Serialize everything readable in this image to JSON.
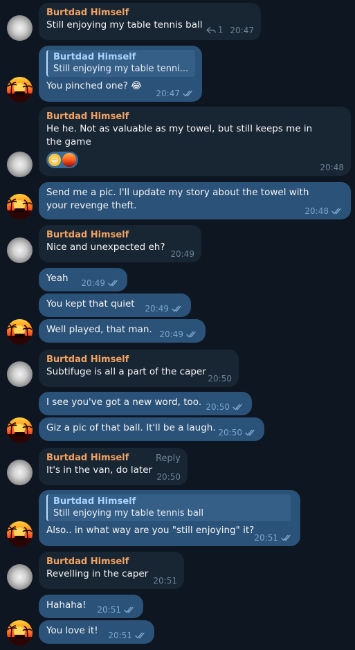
{
  "contact": {
    "name": "Burtdad Himself"
  },
  "messages": [
    {
      "id": "m1",
      "dir": "in",
      "sender": "Burtdad Himself",
      "text": "Still enjoying my table tennis ball",
      "time": "20:47",
      "reply_count": "1"
    },
    {
      "id": "m2",
      "dir": "out",
      "quote_name": "Burtdad Himself",
      "quote_text": "Still enjoying my table tenni...",
      "text": "You pinched one? 😂",
      "time": "20:47"
    },
    {
      "id": "m3",
      "dir": "in",
      "sender": "Burtdad Himself",
      "text": "He he. Not as valuable as my towel, but still keeps me in the game",
      "time": "20:48",
      "reaction_emoji": "😁"
    },
    {
      "id": "m4",
      "dir": "out",
      "text": "Send me a pic. I'll update my story about the towel with your revenge theft.",
      "time": "20:48"
    },
    {
      "id": "m5",
      "dir": "in",
      "sender": "Burtdad Himself",
      "text": "Nice and unexpected eh?",
      "time": "20:49"
    },
    {
      "id": "m6",
      "dir": "out",
      "text": "Yeah",
      "time": "20:49"
    },
    {
      "id": "m7",
      "dir": "out",
      "text": "You kept that quiet",
      "time": "20:49"
    },
    {
      "id": "m8",
      "dir": "out",
      "text": "Well played, that man.",
      "time": "20:49"
    },
    {
      "id": "m9",
      "dir": "in",
      "sender": "Burtdad Himself",
      "text": "Subtifuge is all a part of the caper",
      "time": "20:50"
    },
    {
      "id": "m10",
      "dir": "out",
      "text": "I see you've got a new word, too.",
      "time": "20:50"
    },
    {
      "id": "m11",
      "dir": "out",
      "text": "Giz a pic of that ball. It'll be a laugh.",
      "time": "20:50"
    },
    {
      "id": "m12",
      "dir": "in",
      "sender": "Burtdad Himself",
      "text": "It's in the van, do later",
      "time": "20:50",
      "reply_label": "Reply"
    },
    {
      "id": "m13",
      "dir": "out",
      "quote_name": "Burtdad Himself",
      "quote_text": "Still enjoying my table tennis ball",
      "text": "Also.. in what way are you \"still enjoying\" it?",
      "time": "20:51"
    },
    {
      "id": "m14",
      "dir": "in",
      "sender": "Burtdad Himself",
      "text": "Revelling in the caper",
      "time": "20:51"
    },
    {
      "id": "m15",
      "dir": "out",
      "text": "Hahaha!",
      "time": "20:51"
    },
    {
      "id": "m16",
      "dir": "out",
      "text": "You love it!",
      "time": "20:51"
    }
  ],
  "icons": {
    "read_receipt": "double-check-icon",
    "reply": "reply-arrow-icon",
    "avatar_contact": "blurred-avatar",
    "avatar_self": "sunset-palm-avatar"
  },
  "colors": {
    "background": "#0e1621",
    "incoming_bubble": "#182533",
    "outgoing_bubble": "#2b5278",
    "sender_name": "#f2a261",
    "quote_accent": "#6ab3f3"
  }
}
